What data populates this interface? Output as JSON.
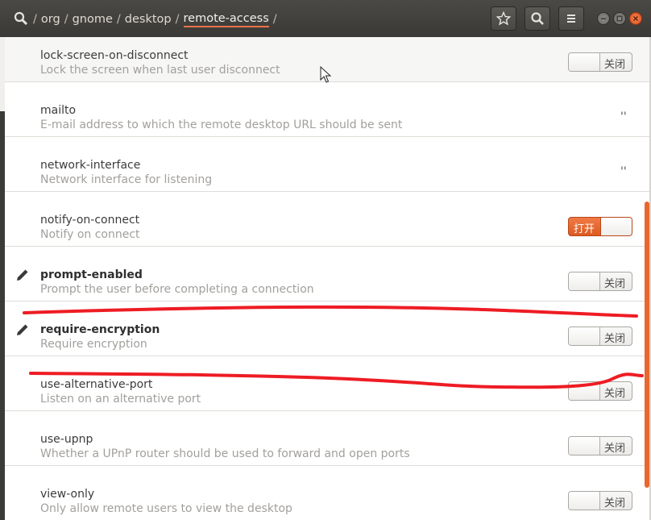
{
  "header": {
    "breadcrumb": [
      "/",
      "org",
      "/",
      "gnome",
      "/",
      "desktop",
      "/",
      "remote-access",
      "/"
    ],
    "buttons": [
      "star-icon",
      "search-icon",
      "menu-icon"
    ]
  },
  "toggle_labels": {
    "off": "关闭",
    "on": "打开"
  },
  "rows": [
    {
      "key": "lock-screen-on-disconnect",
      "desc": "Lock the screen when last user disconnect",
      "control": "toggle",
      "state": "off"
    },
    {
      "key": "mailto",
      "desc": "E-mail address to which the remote desktop URL should be sent",
      "control": "text",
      "value": "''"
    },
    {
      "key": "network-interface",
      "desc": "Network interface for listening",
      "control": "text",
      "value": "''"
    },
    {
      "key": "notify-on-connect",
      "desc": "Notify on connect",
      "control": "toggle",
      "state": "on"
    },
    {
      "key": "prompt-enabled",
      "desc": "Prompt the user before completing a connection",
      "control": "toggle",
      "state": "off",
      "modified": true
    },
    {
      "key": "require-encryption",
      "desc": "Require encryption",
      "control": "toggle",
      "state": "off",
      "modified": true
    },
    {
      "key": "use-alternative-port",
      "desc": "Listen on an alternative port",
      "control": "toggle",
      "state": "off"
    },
    {
      "key": "use-upnp",
      "desc": "Whether a UPnP router should be used to forward and open ports",
      "control": "toggle",
      "state": "off"
    },
    {
      "key": "view-only",
      "desc": "Only allow remote users to view the desktop",
      "control": "toggle",
      "state": "off"
    }
  ],
  "colors": {
    "accent": "#e8734a",
    "scribble": "#ee1c24"
  }
}
